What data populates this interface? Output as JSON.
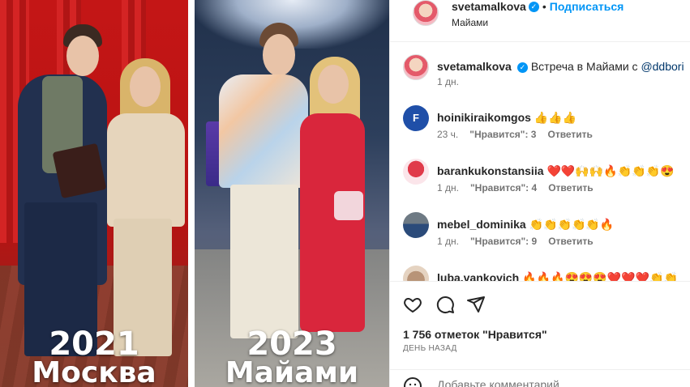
{
  "photo": {
    "left_year": "2021",
    "left_city": "Москва",
    "right_year": "2023",
    "right_city": "Майами"
  },
  "header": {
    "username": "svetamalkova",
    "follow_label": "Подписаться",
    "location": "Майами"
  },
  "caption": {
    "username": "svetamalkova",
    "text": "Встреча в Майами с ",
    "mention": "@ddbori",
    "time": "1 дн."
  },
  "comments": [
    {
      "username": "hoinikiraikomgos",
      "text": "👍👍👍",
      "time": "23 ч.",
      "likes": "\"Нравится\": 3",
      "reply": "Ответить"
    },
    {
      "username": "barankukonstansiia",
      "text": "❤️❤️🙌🙌🔥👏👏👏😍",
      "time": "1 дн.",
      "likes": "\"Нравится\": 4",
      "reply": "Ответить"
    },
    {
      "username": "mebel_dominika",
      "text": "👏👏👏👏👏🔥",
      "time": "1 дн.",
      "likes": "\"Нравится\": 9",
      "reply": "Ответить"
    },
    {
      "username": "luba.vankovich",
      "text": "🔥🔥🔥😍😍😍❤️❤️❤️👏👏",
      "time": "",
      "likes": "",
      "reply": ""
    }
  ],
  "footer": {
    "likes_count": "1 756 отметок \"Нравится\"",
    "date": "ДЕНЬ НАЗАД",
    "add_comment_placeholder": "Добавьте комментарий..."
  },
  "colors": {
    "accent": "#0095f6",
    "muted": "#737373",
    "text": "#262626"
  }
}
